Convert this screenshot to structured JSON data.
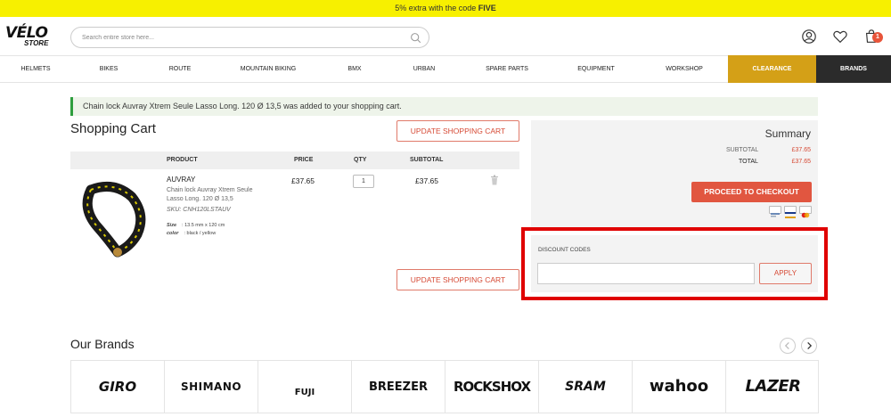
{
  "promo": {
    "text": "5% extra with the code ",
    "code": "FIVE"
  },
  "header": {
    "logo_main": "VÉLO",
    "logo_sub": "STORE",
    "search_placeholder": "Search entire store here...",
    "cart_count": "1"
  },
  "nav": {
    "items": [
      "Helmets",
      "Bikes",
      "Route",
      "Mountain Biking",
      "BMX",
      "Urban",
      "Spare parts",
      "Equipment",
      "Workshop"
    ],
    "clearance": "Clearance",
    "brands": "Brands"
  },
  "notice": "Chain lock Auvray Xtrem Seule Lasso Long. 120 Ø 13,5 was added to your shopping cart.",
  "cart": {
    "title": "Shopping Cart",
    "update_label": "Update Shopping Cart",
    "columns": {
      "product": "PRODUCT",
      "price": "PRICE",
      "qty": "QTY",
      "subtotal": "SUBTOTAL"
    },
    "item": {
      "brand": "AUVRAY",
      "name": "Chain lock Auvray Xtrem Seule Lasso Long. 120 Ø 13,5",
      "sku_label": "SKU:",
      "sku": "CNH120LSTAUV",
      "size_label": "Size",
      "size": ": 13.5 mm x 120 cm",
      "color_label": "color",
      "color": ": black / yellow",
      "price": "£37.65",
      "qty": "1",
      "subtotal": "£37.65"
    }
  },
  "summary": {
    "title": "Summary",
    "subtotal_label": "Subtotal",
    "subtotal": "£37.65",
    "total_label": "Total",
    "total": "£37.65",
    "checkout_label": "Proceed to Checkout"
  },
  "discount": {
    "label": "Discount Codes",
    "input_value": "",
    "apply_label": "Apply"
  },
  "brands_section": {
    "title": "Our Brands",
    "logos": [
      "GIRO",
      "SHIMANO",
      "FUJI",
      "BREEZER",
      "ROCKSHOX",
      "SRAM",
      "wahoo",
      "LAZER"
    ]
  },
  "colors": {
    "promo_bg": "#f7f000",
    "accent": "#e15640",
    "clearance": "#d4a017",
    "brands_nav": "#2b2b2b",
    "highlight": "#e00000",
    "success": "#2e9e3e"
  }
}
